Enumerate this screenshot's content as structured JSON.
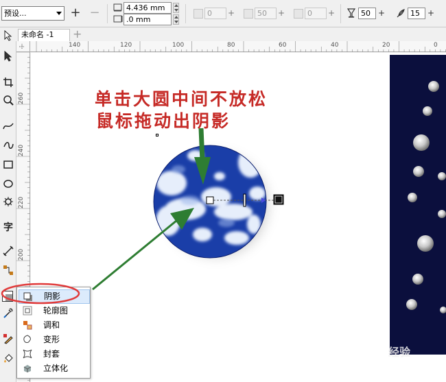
{
  "propbar": {
    "preset": "预设...",
    "add_btn": "+",
    "remove_btn": "−",
    "width_value": "4.436 mm",
    "height_value": ".0 mm",
    "offset_x": "0",
    "offset_y": "50",
    "offset_z": "0",
    "opacity": "50",
    "feather": "15"
  },
  "tabs": {
    "doc_tab": "未命名 -1",
    "add_tab": "+"
  },
  "ruler": {
    "h_labels": [
      "140",
      "120",
      "100",
      "80",
      "60",
      "40",
      "20",
      "0"
    ],
    "v_labels": [
      "260",
      "240",
      "220",
      "200"
    ]
  },
  "annotation": {
    "line1": "单击大圆中间不放松",
    "line2": "鼠标拖动出阴影"
  },
  "flyout": {
    "items": [
      {
        "label": "阴影",
        "icon": "drop-shadow-icon"
      },
      {
        "label": "轮廓图",
        "icon": "contour-icon"
      },
      {
        "label": "调和",
        "icon": "blend-icon"
      },
      {
        "label": "变形",
        "icon": "distort-icon"
      },
      {
        "label": "封套",
        "icon": "envelope-icon"
      },
      {
        "label": "立体化",
        "icon": "extrude-icon"
      }
    ]
  },
  "watermark": "经验",
  "colors": {
    "annotation_red": "#c62a26",
    "arrow_green": "#2e7d32",
    "highlight_red": "#e03a3a",
    "globe_blue": "#1a3ea8",
    "dark_panel": "#0b0f3d"
  }
}
